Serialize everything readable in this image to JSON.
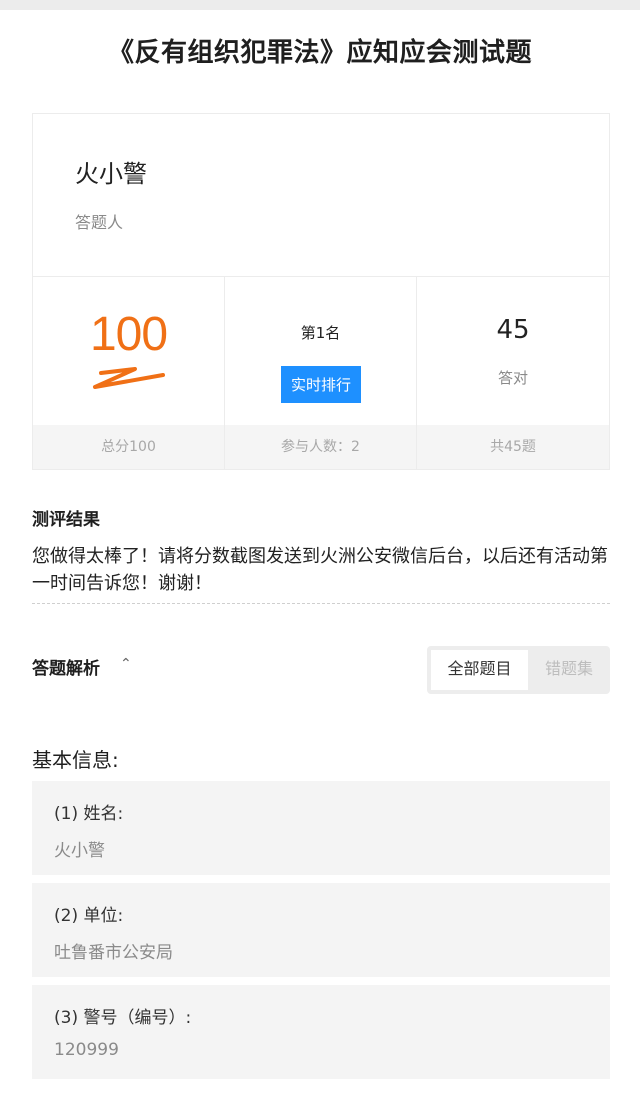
{
  "page": {
    "title": "《反有组织犯罪法》应知应会测试题"
  },
  "profile": {
    "name": "火小警",
    "role": "答题人"
  },
  "stats": {
    "score": "100",
    "score_footer": "总分100",
    "rank_text": "第1名",
    "rank_button": "实时排行",
    "participants": "参与人数：2",
    "correct_count": "45",
    "correct_label": "答对",
    "total": "共45题"
  },
  "result": {
    "heading": "测评结果",
    "text": "您做得太棒了！请将分数截图发送到火洲公安微信后台，以后还有活动第一时间告诉您！谢谢！"
  },
  "analysis": {
    "heading": "答题解析",
    "tabs": [
      {
        "label": "全部题目",
        "active": true
      },
      {
        "label": "错题集",
        "active": false
      }
    ]
  },
  "basic_info": {
    "heading": "基本信息:",
    "fields": [
      {
        "question": "(1) 姓名:",
        "answer": "火小警"
      },
      {
        "question": "(2) 单位:",
        "answer": "吐鲁番市公安局"
      },
      {
        "question": "(3) 警号（编号）:",
        "answer": "120999"
      }
    ]
  },
  "colors": {
    "accent_blue": "#1e90ff",
    "score_orange": "#f07016"
  }
}
